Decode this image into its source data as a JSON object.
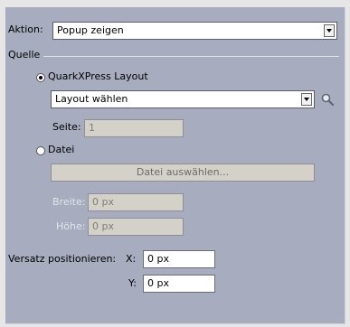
{
  "action": {
    "label": "Aktion:",
    "value": "Popup zeigen"
  },
  "source": {
    "label": "Quelle",
    "layout_radio": {
      "label": "QuarkXPress Layout",
      "selected": true
    },
    "layout_select": {
      "value": "Layout wählen"
    },
    "page": {
      "label": "Seite:",
      "value": "1"
    },
    "file_radio": {
      "label": "Datei",
      "selected": false
    },
    "file_button": {
      "label": "Datei auswählen..."
    },
    "width": {
      "label": "Breite:",
      "value": "0 px"
    },
    "height": {
      "label": "Höhe:",
      "value": "0 px"
    }
  },
  "offset": {
    "label": "Versatz positionieren:",
    "x": {
      "label": "X:",
      "value": "0 px"
    },
    "y": {
      "label": "Y:",
      "value": "0 px"
    }
  },
  "icons": {
    "magnifier": "magnifier-icon",
    "dropdown": "chevron-down-icon"
  }
}
